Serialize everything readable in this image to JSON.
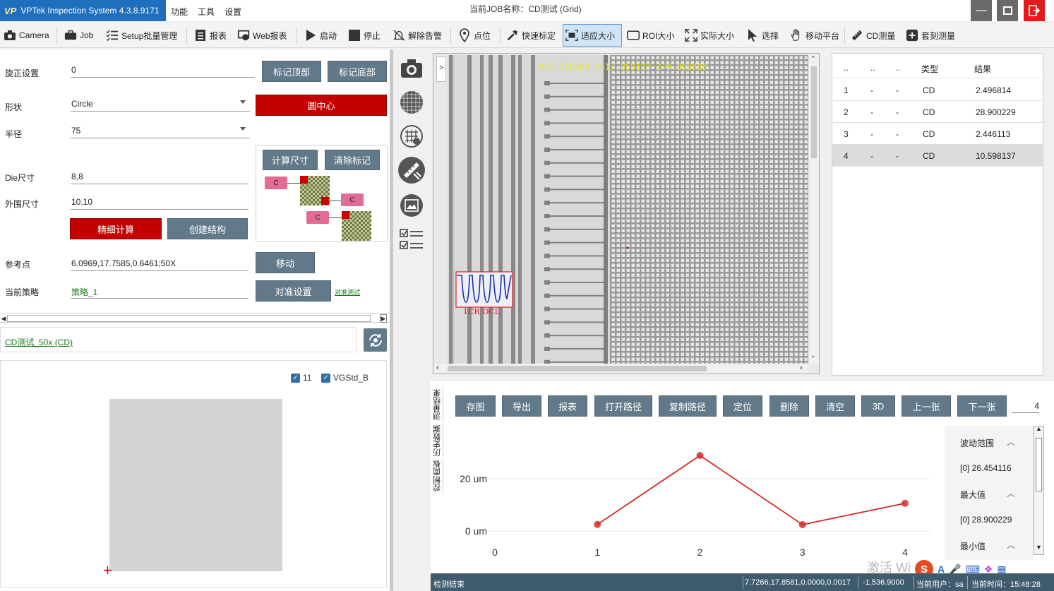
{
  "window": {
    "app_name": "VPTek Inspection System 4.3.8.9171",
    "logo_text": "VP",
    "job_title": "当前JOB名称：CD测试 (Grid)"
  },
  "menu": [
    "功能",
    "工具",
    "设置"
  ],
  "toolbar": {
    "camera": "Camera",
    "job": "Job",
    "setup_batch": "Setup批量管理",
    "report": "报表",
    "web_report": "Web报表",
    "start": "启动",
    "stop": "停止",
    "clear_alarm": "解除告警",
    "point": "点位",
    "quick_calibrate": "快速标定",
    "fit_size": "适应大小",
    "roi_size": "ROI大小",
    "actual_size": "实际大小",
    "select": "选择",
    "move_stage": "移动平台",
    "cd_measure": "CD测量",
    "overlay_measure": "套刻测量"
  },
  "settings": {
    "rotation_label": "旋正设置",
    "rotation_value": "0",
    "mark_top": "标记顶部",
    "mark_bottom": "标记底部",
    "shape_label": "形状",
    "shape_value": "Circle",
    "circle_center": "圆中心",
    "radius_label": "半径",
    "radius_value": "75",
    "calc_size": "计算尺寸",
    "clear_marks": "清除标记",
    "die_label": "Die尺寸",
    "die_value": "8,8",
    "outer_label": "外围尺寸",
    "outer_value": "10,10",
    "fine_calc": "精细计算",
    "create_struct": "创建结构",
    "ref_label": "参考点",
    "ref_value": "6.0969,17.7585,0.6461;50X",
    "move": "移动",
    "strategy_label": "当前策略",
    "strategy_value": "策略_1",
    "align_settings": "对准设置",
    "align_test": "对准测试",
    "diagram_c": "C"
  },
  "cd_link": "CD测试_50x (CD)",
  "preview": {
    "check1": "11",
    "check2": "VGStd_B"
  },
  "viewer": {
    "coords": "X=7.726594 Y=17.858123 Z=0.000000",
    "roi_label": "1CR OCL",
    "expand": ">"
  },
  "results": {
    "headers": [
      "..",
      "..",
      "..",
      "类型",
      "结果"
    ],
    "rows": [
      {
        "id": "1",
        "a": "-",
        "b": "-",
        "type": "CD",
        "value": "2.496814"
      },
      {
        "id": "2",
        "a": "-",
        "b": "-",
        "type": "CD",
        "value": "28.900229"
      },
      {
        "id": "3",
        "a": "-",
        "b": "-",
        "type": "CD",
        "value": "2.446113"
      },
      {
        "id": "4",
        "a": "-",
        "b": "-",
        "type": "CD",
        "value": "10.598137"
      }
    ],
    "selected_index": 3
  },
  "side_tabs": [
    "测量结果",
    "历史数据",
    "控制面板"
  ],
  "lower_buttons": [
    "存图",
    "导出",
    "报表",
    "打开路径",
    "复制路径",
    "定位",
    "删除",
    "清空",
    "3D",
    "上一张",
    "下一张"
  ],
  "count": "4",
  "chart_data": {
    "type": "line",
    "x": [
      1,
      2,
      3,
      4
    ],
    "y": [
      2.496814,
      28.900229,
      2.446113,
      10.598137
    ],
    "x_ticks": [
      "0",
      "1",
      "2",
      "3",
      "4"
    ],
    "y_ticks": [
      "0 um",
      "20 um"
    ],
    "xlim": [
      0,
      4
    ],
    "ylim": [
      0,
      20
    ],
    "grid": true,
    "color": "#d62b2b"
  },
  "stats": [
    {
      "label": "波动范围",
      "kind": "header"
    },
    {
      "label": "[0]   26.454116",
      "kind": "value"
    },
    {
      "label": "最大值",
      "kind": "header"
    },
    {
      "label": "[0]   28.900229",
      "kind": "value"
    },
    {
      "label": "最小值",
      "kind": "header"
    }
  ],
  "status": {
    "state": "检测结束",
    "position": "7.7266,17.8581,0.0000,0.0017",
    "value": "-1,536.9000",
    "user": "当前用户：sa",
    "time": "当前时间：15:48:28"
  },
  "watermark": "激活 Wi",
  "colors": {
    "accent": "#1f6fbf",
    "button": "#62798a",
    "danger": "#c40000",
    "status_bar": "#3f5b6e",
    "link": "#1a7a1a"
  }
}
